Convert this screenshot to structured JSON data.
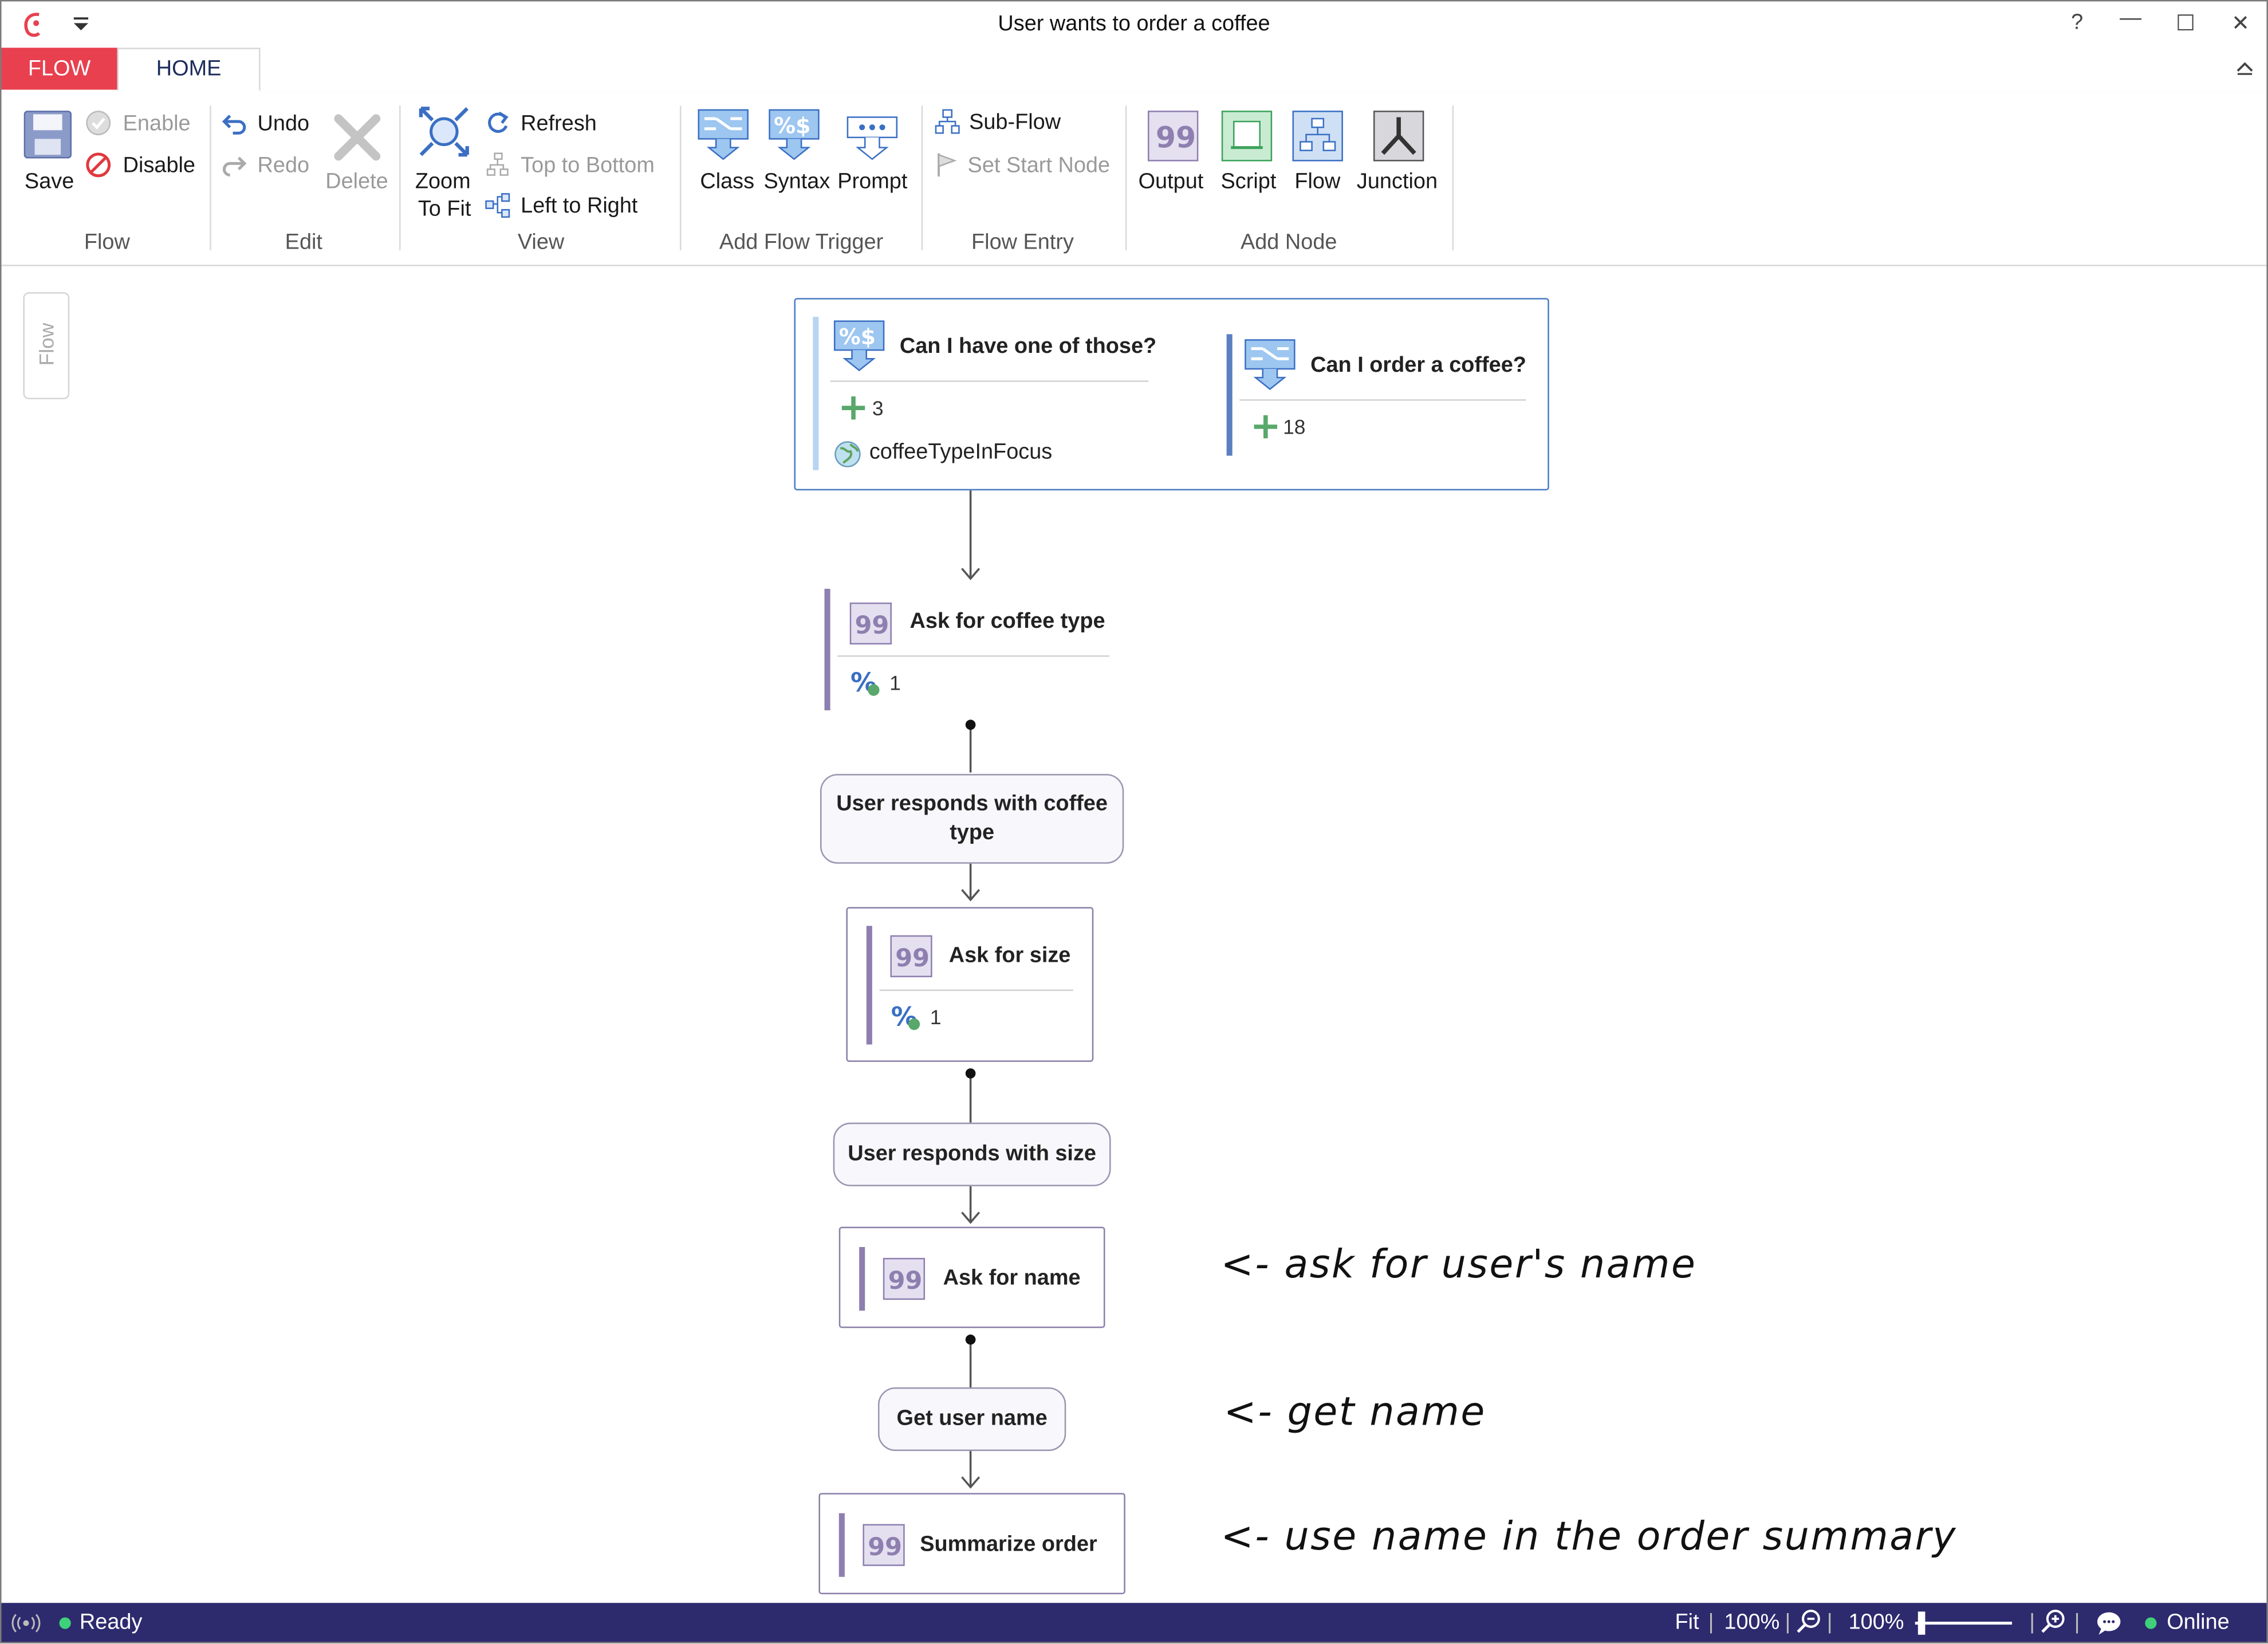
{
  "window": {
    "title": "User wants to order a coffee",
    "help": "?",
    "minimize": "—",
    "maximize": "☐",
    "close": "✕"
  },
  "tabs": {
    "flow": "FLOW",
    "home": "HOME"
  },
  "ribbon": {
    "save": "Save",
    "enable": "Enable",
    "disable": "Disable",
    "undo": "Undo",
    "redo": "Redo",
    "delete": "Delete",
    "zoom_line1": "Zoom",
    "zoom_line2": "To Fit",
    "refresh": "Refresh",
    "top_to_bottom": "Top to Bottom",
    "left_to_right": "Left to Right",
    "class": "Class",
    "syntax": "Syntax",
    "prompt": "Prompt",
    "sub_flow": "Sub-Flow",
    "set_start_node": "Set Start Node",
    "output": "Output",
    "script": "Script",
    "flow": "Flow",
    "junction": "Junction",
    "groups": {
      "flow": "Flow",
      "edit": "Edit",
      "view": "View",
      "add_flow_trigger": "Add Flow Trigger",
      "flow_entry": "Flow Entry",
      "add_node": "Add Node"
    }
  },
  "side_panel": {
    "flow_tab": "Flow"
  },
  "canvas": {
    "trigger_a": {
      "title": "Can I have one of those?",
      "count": "3",
      "variable": "coffeeTypeInFocus"
    },
    "trigger_b": {
      "title": "Can I order a coffee?",
      "count": "18"
    },
    "ask_coffee_type": {
      "title": "Ask for coffee type",
      "count": "1"
    },
    "responds_coffee_type": {
      "label": "User responds with coffee type"
    },
    "ask_size": {
      "title": "Ask for size",
      "count": "1"
    },
    "responds_size": {
      "label": "User responds with size"
    },
    "ask_name": {
      "title": "Ask for name"
    },
    "get_user_name": {
      "label": "Get user name"
    },
    "summarize": {
      "title": "Summarize order"
    }
  },
  "annotations": {
    "ask_name": "<- ask for user's name",
    "get_name": "<- get name",
    "summary": "<- use name in the order summary"
  },
  "status": {
    "ready": "Ready",
    "fit": "Fit",
    "zoom1": "100%",
    "zoom2": "100%",
    "slider_level": 0.03,
    "online": "Online"
  },
  "colors": {
    "flow_tab_bg": "#e8404f",
    "status_bg": "#2d2a6e",
    "node_bar": "#8e7fb0",
    "trigger_border": "#4a7bc4",
    "online_dot": "#3fd17a"
  }
}
